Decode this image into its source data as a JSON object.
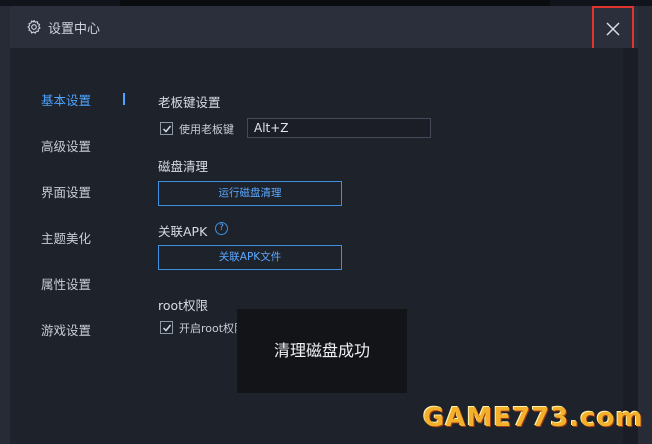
{
  "window": {
    "title": "设置中心"
  },
  "nav": {
    "items": [
      {
        "label": "基本设置",
        "active": true
      },
      {
        "label": "高级设置",
        "active": false
      },
      {
        "label": "界面设置",
        "active": false
      },
      {
        "label": "主题美化",
        "active": false
      },
      {
        "label": "属性设置",
        "active": false
      },
      {
        "label": "游戏设置",
        "active": false
      }
    ]
  },
  "boss_key": {
    "title": "老板键设置",
    "checkbox_label": "使用老板键",
    "checked": true,
    "value": "Alt+Z"
  },
  "disk": {
    "title": "磁盘清理",
    "button_label": "运行磁盘清理"
  },
  "apk": {
    "title": "关联APK",
    "help_symbol": "?",
    "button_label": "关联APK文件"
  },
  "root": {
    "title": "root权限",
    "checkbox_label": "开启root权限",
    "checked": true
  },
  "toast": {
    "message": "清理磁盘成功"
  },
  "watermark": {
    "text": "GAME773.com"
  },
  "colors": {
    "accent": "#4ea3ff",
    "close_highlight": "#e0342f",
    "background": "#1e222b"
  }
}
